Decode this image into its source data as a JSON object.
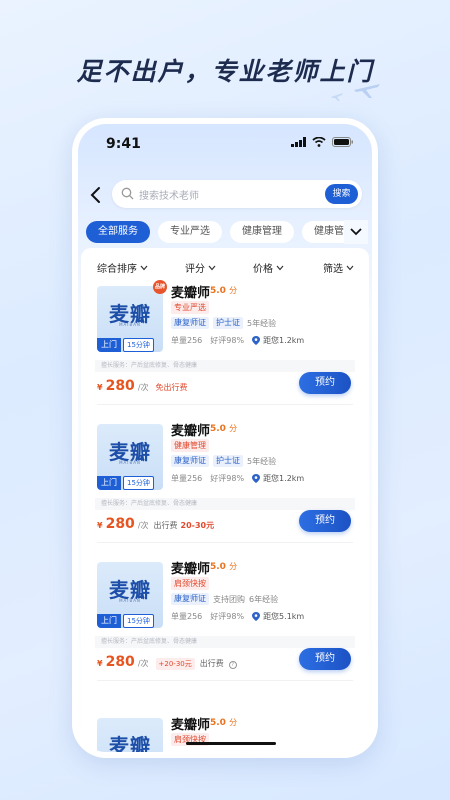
{
  "headline": "足不出户，专业老师上门",
  "status_bar": {
    "time": "9:41"
  },
  "search": {
    "placeholder": "搜索技术老师",
    "button_label": "搜索"
  },
  "tabs": [
    {
      "label": "全部服务",
      "active": true
    },
    {
      "label": "专业严选",
      "active": false
    },
    {
      "label": "健康管理",
      "active": false
    },
    {
      "label": "健康管理",
      "active": false
    }
  ],
  "filters": [
    {
      "label": "综合排序"
    },
    {
      "label": "评分"
    },
    {
      "label": "价格"
    },
    {
      "label": "筛选"
    }
  ],
  "cards": [
    {
      "thumb_logo": "麦瓣",
      "thumb_sub": "MAIBAN",
      "badge_visit": "上门",
      "badge_time": "15分钟",
      "hot_mark": "品牌",
      "name": "麦瓣师",
      "score": "5.0",
      "score_unit": "分",
      "tag": "专业严选",
      "certs": [
        "康复师证",
        "护士证"
      ],
      "exp": "5年经验",
      "orders": "单量256",
      "rating": "好评98%",
      "distance": "距您1.2km",
      "skills": "擅长服务：产后盆底修复、骨态健康",
      "currency": "¥",
      "price": "280",
      "per": "/次",
      "fee_text": "免出行费"
    },
    {
      "thumb_logo": "麦瓣",
      "thumb_sub": "MAIBAN",
      "badge_visit": "上门",
      "badge_time": "15分钟",
      "name": "麦瓣师",
      "score": "5.0",
      "score_unit": "分",
      "tag": "健康管理",
      "certs": [
        "康复师证",
        "护士证"
      ],
      "exp": "5年经验",
      "orders": "单量256",
      "rating": "好评98%",
      "distance": "距您1.2km",
      "skills": "擅长服务：产后盆底修复、骨态健康",
      "currency": "¥",
      "price": "280",
      "per": "/次",
      "fee_label": "出行费",
      "fee_range": "20-30元"
    },
    {
      "thumb_logo": "麦瓣",
      "thumb_sub": "MAIBAN",
      "badge_visit": "上门",
      "badge_time": "15分钟",
      "name": "麦瓣师",
      "score": "5.0",
      "score_unit": "分",
      "tag": "肩颈快按",
      "certs": [
        "康复师证"
      ],
      "extra": "支持团购",
      "exp": "6年经验",
      "orders": "单量256",
      "rating": "好评98%",
      "distance": "距您5.1km",
      "skills": "擅长服务：产后盆底修复、骨态健康",
      "currency": "¥",
      "price": "280",
      "per": "/次",
      "fee_chip": "+20-30元",
      "fee_label": "出行费"
    },
    {
      "thumb_logo": "麦瓣",
      "name": "麦瓣师",
      "score": "5.0",
      "score_unit": "分",
      "tag": "肩颈快按"
    }
  ],
  "book_label": "预约",
  "colors": {
    "brand": "#1f5fd6",
    "price": "#e8541f",
    "score": "#e8741f"
  }
}
